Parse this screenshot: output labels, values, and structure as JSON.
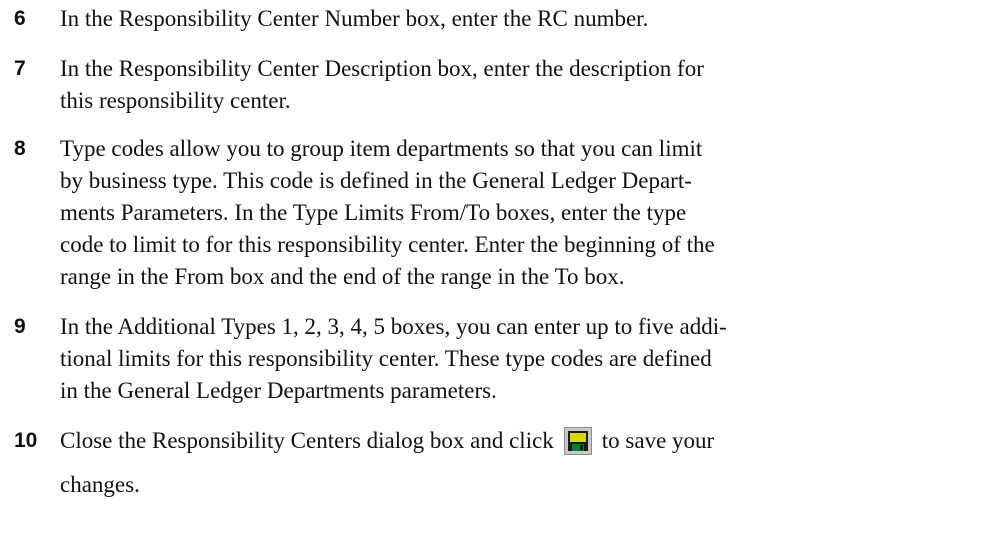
{
  "steps": [
    {
      "number": "6",
      "lines": [
        "In the Responsibility Center Number box, enter the RC number."
      ]
    },
    {
      "number": "7",
      "lines": [
        "In the Responsibility Center Description box, enter the description for",
        "this responsibility center."
      ]
    },
    {
      "number": "8",
      "lines": [
        "Type codes allow you to group item departments so that you can limit",
        "by business type. This code is defined in the General Ledger Depart-",
        "ments Parameters. In the Type Limits From/To boxes, enter the type",
        "code to limit to for this responsibility center. Enter the beginning of the",
        "range in the From box and the end of the range in the To box."
      ]
    },
    {
      "number": "9",
      "lines": [
        "In the Additional Types 1, 2, 3, 4, 5 boxes, you can enter up to five addi-",
        "tional limits for this responsibility center. These type codes are defined",
        "in the General Ledger Departments parameters."
      ]
    },
    {
      "number": "10",
      "line_before_icon": "Close the Responsibility Centers dialog box and click",
      "icon": "save-icon",
      "line_after_icon": "to save your",
      "continuation": "changes."
    }
  ]
}
